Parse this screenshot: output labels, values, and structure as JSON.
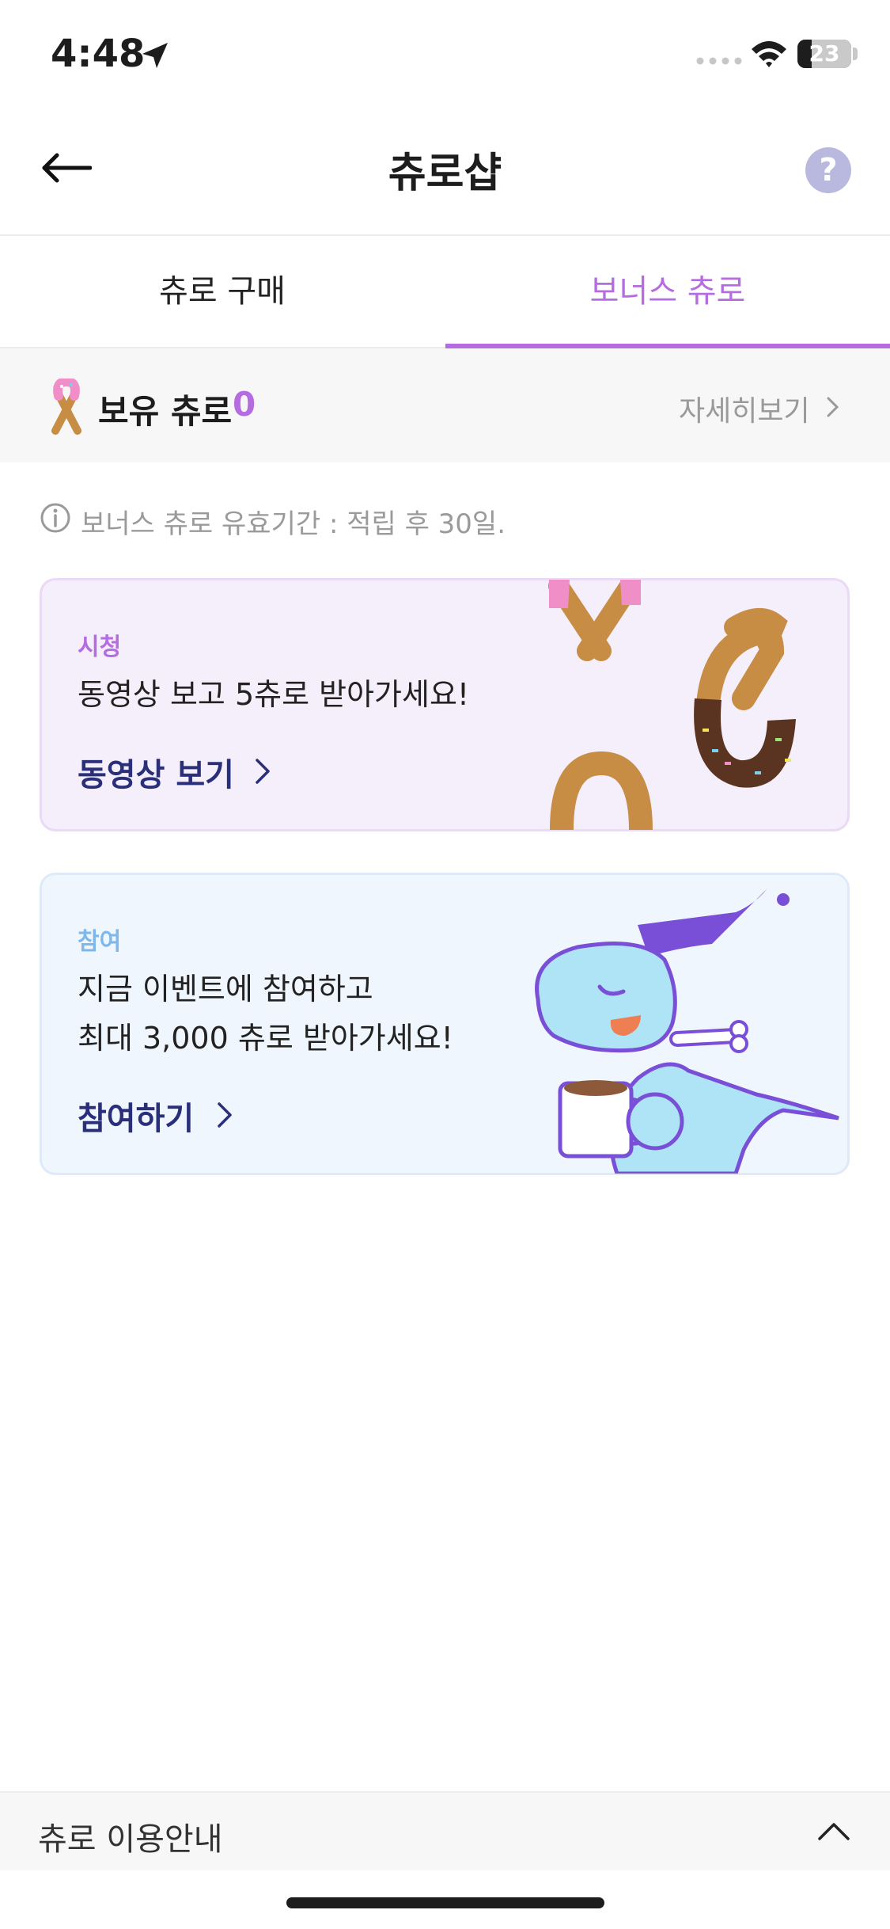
{
  "status_bar": {
    "time": "4:48",
    "battery_level": "23",
    "icons": [
      "location-arrow-icon",
      "signal-icon",
      "wifi-icon",
      "battery-icon"
    ]
  },
  "header": {
    "title": "츄로샵",
    "help_symbol": "?",
    "icons": [
      "back-arrow-icon",
      "help-icon"
    ]
  },
  "tabs": [
    {
      "label": "츄로 구매",
      "active": false
    },
    {
      "label": "보너스 츄로",
      "active": true
    }
  ],
  "balance": {
    "label": "보유 츄로",
    "value": "0",
    "detail_link": "자세히보기"
  },
  "info": {
    "text": "보너스 츄로 유효기간 : 적립 후 30일."
  },
  "cards": [
    {
      "tag": "시청",
      "description": "동영상 보고 5츄로 받아가세요!",
      "action": "동영상 보기"
    },
    {
      "tag": "참여",
      "description_line1": "지금 이벤트에 참여하고",
      "description_line2": "최대 3,000 츄로 받아가세요!",
      "action": "참여하기"
    }
  ],
  "guide": {
    "label": "츄로 이용안내"
  },
  "colors": {
    "accent_purple": "#b46ce0",
    "action_navy": "#2a2f7a",
    "join_tag_blue": "#7eb7ea",
    "watch_card_bg": "#f5eefb",
    "join_card_bg": "#f0f6fd"
  }
}
